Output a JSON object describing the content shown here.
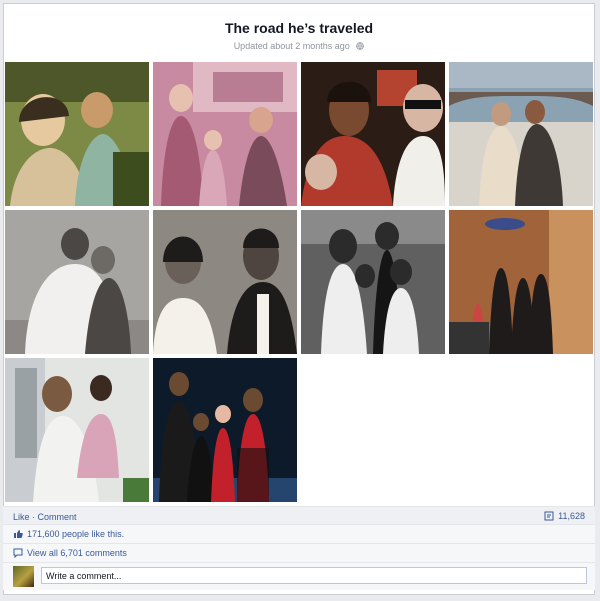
{
  "album": {
    "title": "The road he’s traveled",
    "updated": "Updated about 2 months ago",
    "privacy_icon": "globe-icon"
  },
  "photos": [
    {
      "name": "photo-1",
      "palette": [
        "#7c8a45",
        "#e7c9a0",
        "#3a2f1f"
      ]
    },
    {
      "name": "photo-2",
      "palette": [
        "#c88aa0",
        "#e7c1b0",
        "#7a4b5a"
      ]
    },
    {
      "name": "photo-3",
      "palette": [
        "#2b1c16",
        "#d7b7a3",
        "#b23a2c"
      ]
    },
    {
      "name": "photo-4",
      "palette": [
        "#8aa2b2",
        "#d9d4cb",
        "#3f3936"
      ]
    },
    {
      "name": "photo-5",
      "palette": [
        "#a7a5a2",
        "#d6d3ce",
        "#4a4744"
      ]
    },
    {
      "name": "photo-6",
      "palette": [
        "#8e8883",
        "#f4f0ea",
        "#1e1c1b"
      ]
    },
    {
      "name": "photo-7",
      "palette": [
        "#606060",
        "#eeeeee",
        "#151515"
      ]
    },
    {
      "name": "photo-8",
      "palette": [
        "#a1633a",
        "#d7a77a",
        "#1f1b1a"
      ]
    },
    {
      "name": "photo-9",
      "palette": [
        "#e3e5e3",
        "#9aa1a4",
        "#d9a4b8"
      ]
    },
    {
      "name": "photo-10",
      "palette": [
        "#0d1a2a",
        "#c2202a",
        "#e8b9a2"
      ]
    }
  ],
  "actions": {
    "like": "Like",
    "separator": " · ",
    "comment": "Comment",
    "share_count": "11,628"
  },
  "likes": {
    "text": "171,600 people like this."
  },
  "comments": {
    "view_all": "View all 6,701 comments"
  },
  "composer": {
    "placeholder": "Write a comment..."
  }
}
